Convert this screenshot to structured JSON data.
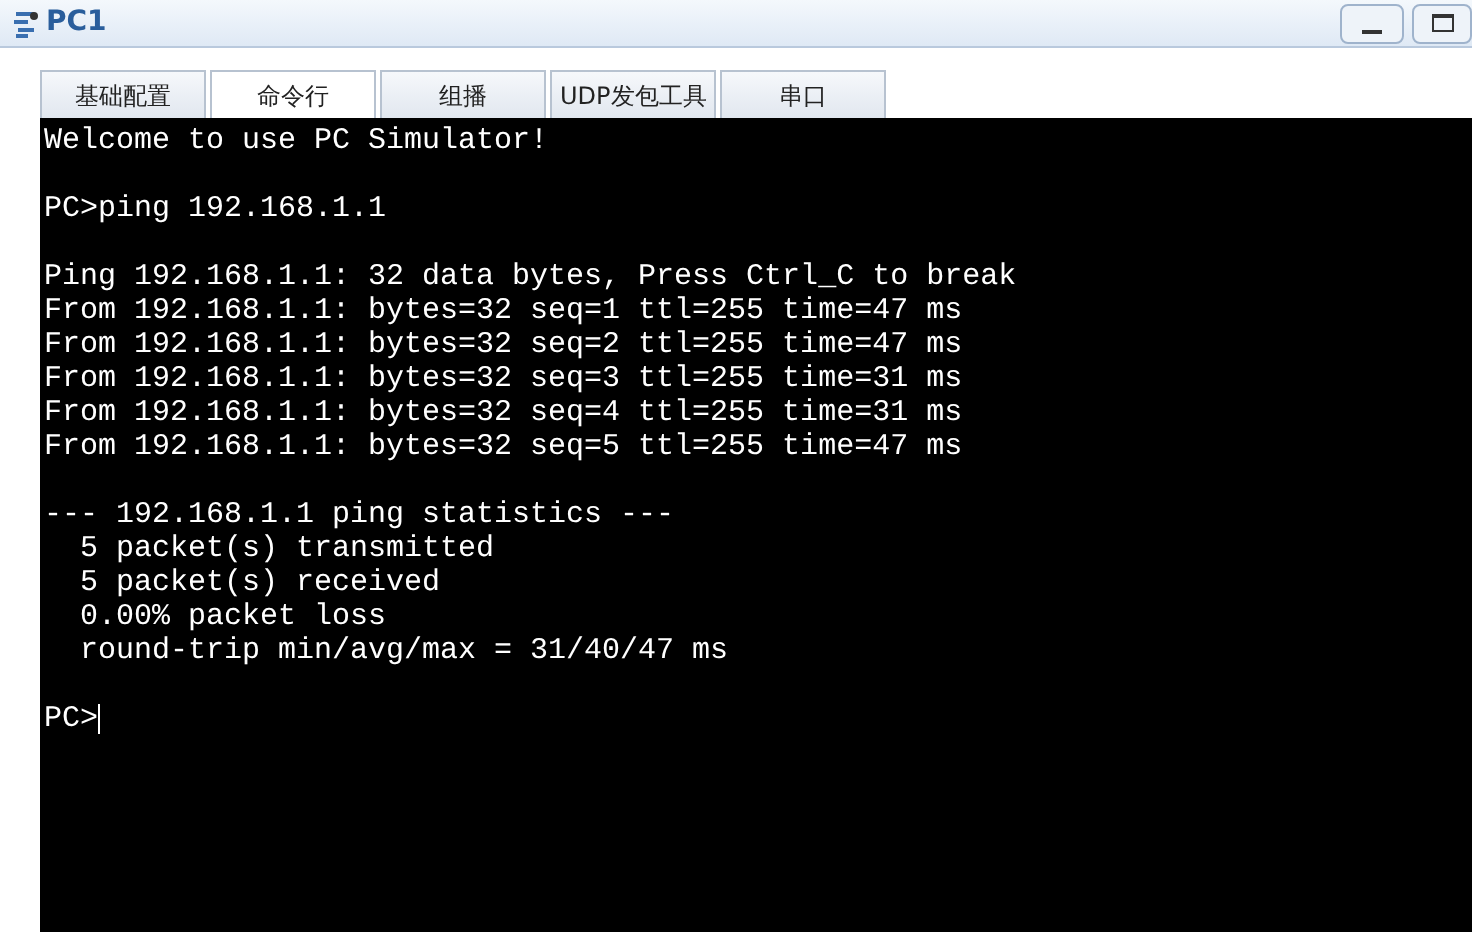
{
  "window": {
    "title": "PC1"
  },
  "tabs": [
    {
      "label": "基础配置",
      "selected": false
    },
    {
      "label": "命令行",
      "selected": true
    },
    {
      "label": "组播",
      "selected": false
    },
    {
      "label": "UDP发包工具",
      "selected": false
    },
    {
      "label": "串口",
      "selected": false
    }
  ],
  "terminal": {
    "blocks": [
      [
        "Welcome to use PC Simulator!"
      ],
      [
        "PC>ping 192.168.1.1"
      ],
      [
        "Ping 192.168.1.1: 32 data bytes, Press Ctrl_C to break",
        "From 192.168.1.1: bytes=32 seq=1 ttl=255 time=47 ms",
        "From 192.168.1.1: bytes=32 seq=2 ttl=255 time=47 ms",
        "From 192.168.1.1: bytes=32 seq=3 ttl=255 time=31 ms",
        "From 192.168.1.1: bytes=32 seq=4 ttl=255 time=31 ms",
        "From 192.168.1.1: bytes=32 seq=5 ttl=255 time=47 ms"
      ],
      [
        "--- 192.168.1.1 ping statistics ---",
        "  5 packet(s) transmitted",
        "  5 packet(s) received",
        "  0.00% packet loss",
        "  round-trip min/avg/max = 31/40/47 ms"
      ]
    ],
    "prompt": "PC>"
  }
}
